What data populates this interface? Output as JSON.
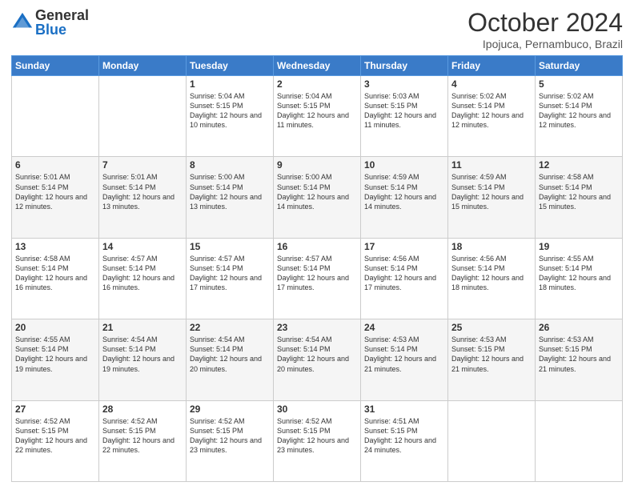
{
  "header": {
    "logo_general": "General",
    "logo_blue": "Blue",
    "title": "October 2024",
    "subtitle": "Ipojuca, Pernambuco, Brazil"
  },
  "days_of_week": [
    "Sunday",
    "Monday",
    "Tuesday",
    "Wednesday",
    "Thursday",
    "Friday",
    "Saturday"
  ],
  "weeks": [
    [
      {
        "day": "",
        "info": ""
      },
      {
        "day": "",
        "info": ""
      },
      {
        "day": "1",
        "info": "Sunrise: 5:04 AM\nSunset: 5:15 PM\nDaylight: 12 hours and 10 minutes."
      },
      {
        "day": "2",
        "info": "Sunrise: 5:04 AM\nSunset: 5:15 PM\nDaylight: 12 hours and 11 minutes."
      },
      {
        "day": "3",
        "info": "Sunrise: 5:03 AM\nSunset: 5:15 PM\nDaylight: 12 hours and 11 minutes."
      },
      {
        "day": "4",
        "info": "Sunrise: 5:02 AM\nSunset: 5:14 PM\nDaylight: 12 hours and 12 minutes."
      },
      {
        "day": "5",
        "info": "Sunrise: 5:02 AM\nSunset: 5:14 PM\nDaylight: 12 hours and 12 minutes."
      }
    ],
    [
      {
        "day": "6",
        "info": "Sunrise: 5:01 AM\nSunset: 5:14 PM\nDaylight: 12 hours and 12 minutes."
      },
      {
        "day": "7",
        "info": "Sunrise: 5:01 AM\nSunset: 5:14 PM\nDaylight: 12 hours and 13 minutes."
      },
      {
        "day": "8",
        "info": "Sunrise: 5:00 AM\nSunset: 5:14 PM\nDaylight: 12 hours and 13 minutes."
      },
      {
        "day": "9",
        "info": "Sunrise: 5:00 AM\nSunset: 5:14 PM\nDaylight: 12 hours and 14 minutes."
      },
      {
        "day": "10",
        "info": "Sunrise: 4:59 AM\nSunset: 5:14 PM\nDaylight: 12 hours and 14 minutes."
      },
      {
        "day": "11",
        "info": "Sunrise: 4:59 AM\nSunset: 5:14 PM\nDaylight: 12 hours and 15 minutes."
      },
      {
        "day": "12",
        "info": "Sunrise: 4:58 AM\nSunset: 5:14 PM\nDaylight: 12 hours and 15 minutes."
      }
    ],
    [
      {
        "day": "13",
        "info": "Sunrise: 4:58 AM\nSunset: 5:14 PM\nDaylight: 12 hours and 16 minutes."
      },
      {
        "day": "14",
        "info": "Sunrise: 4:57 AM\nSunset: 5:14 PM\nDaylight: 12 hours and 16 minutes."
      },
      {
        "day": "15",
        "info": "Sunrise: 4:57 AM\nSunset: 5:14 PM\nDaylight: 12 hours and 17 minutes."
      },
      {
        "day": "16",
        "info": "Sunrise: 4:57 AM\nSunset: 5:14 PM\nDaylight: 12 hours and 17 minutes."
      },
      {
        "day": "17",
        "info": "Sunrise: 4:56 AM\nSunset: 5:14 PM\nDaylight: 12 hours and 17 minutes."
      },
      {
        "day": "18",
        "info": "Sunrise: 4:56 AM\nSunset: 5:14 PM\nDaylight: 12 hours and 18 minutes."
      },
      {
        "day": "19",
        "info": "Sunrise: 4:55 AM\nSunset: 5:14 PM\nDaylight: 12 hours and 18 minutes."
      }
    ],
    [
      {
        "day": "20",
        "info": "Sunrise: 4:55 AM\nSunset: 5:14 PM\nDaylight: 12 hours and 19 minutes."
      },
      {
        "day": "21",
        "info": "Sunrise: 4:54 AM\nSunset: 5:14 PM\nDaylight: 12 hours and 19 minutes."
      },
      {
        "day": "22",
        "info": "Sunrise: 4:54 AM\nSunset: 5:14 PM\nDaylight: 12 hours and 20 minutes."
      },
      {
        "day": "23",
        "info": "Sunrise: 4:54 AM\nSunset: 5:14 PM\nDaylight: 12 hours and 20 minutes."
      },
      {
        "day": "24",
        "info": "Sunrise: 4:53 AM\nSunset: 5:14 PM\nDaylight: 12 hours and 21 minutes."
      },
      {
        "day": "25",
        "info": "Sunrise: 4:53 AM\nSunset: 5:15 PM\nDaylight: 12 hours and 21 minutes."
      },
      {
        "day": "26",
        "info": "Sunrise: 4:53 AM\nSunset: 5:15 PM\nDaylight: 12 hours and 21 minutes."
      }
    ],
    [
      {
        "day": "27",
        "info": "Sunrise: 4:52 AM\nSunset: 5:15 PM\nDaylight: 12 hours and 22 minutes."
      },
      {
        "day": "28",
        "info": "Sunrise: 4:52 AM\nSunset: 5:15 PM\nDaylight: 12 hours and 22 minutes."
      },
      {
        "day": "29",
        "info": "Sunrise: 4:52 AM\nSunset: 5:15 PM\nDaylight: 12 hours and 23 minutes."
      },
      {
        "day": "30",
        "info": "Sunrise: 4:52 AM\nSunset: 5:15 PM\nDaylight: 12 hours and 23 minutes."
      },
      {
        "day": "31",
        "info": "Sunrise: 4:51 AM\nSunset: 5:15 PM\nDaylight: 12 hours and 24 minutes."
      },
      {
        "day": "",
        "info": ""
      },
      {
        "day": "",
        "info": ""
      }
    ]
  ]
}
